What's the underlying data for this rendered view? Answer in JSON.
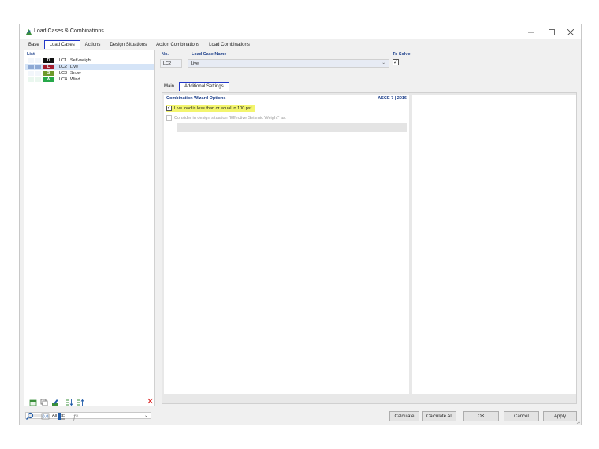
{
  "window": {
    "title": "Load Cases & Combinations"
  },
  "tabs": [
    {
      "label": "Base"
    },
    {
      "label": "Load Cases",
      "active": true
    },
    {
      "label": "Actions"
    },
    {
      "label": "Design Situations"
    },
    {
      "label": "Action Combinations"
    },
    {
      "label": "Load Combinations"
    }
  ],
  "list": {
    "title": "List",
    "items": [
      {
        "badge": "D",
        "badge_color": "#111111",
        "no": "LC1",
        "name": "Self-weight",
        "selected": false
      },
      {
        "badge": "L",
        "badge_color": "#a31c2e",
        "no": "LC2",
        "name": "Live",
        "selected": true
      },
      {
        "badge": "S",
        "badge_color": "#2d8a2d",
        "no": "LC3",
        "name": "Snow",
        "selected": false
      },
      {
        "badge": "W",
        "badge_color": "#27a84a",
        "no": "LC4",
        "name": "Wind",
        "selected": false
      }
    ],
    "filter_value": "All (4)"
  },
  "header": {
    "no_label": "No.",
    "no_value": "LC2",
    "name_label": "Load Case Name",
    "name_value": "Live",
    "solve_label": "To Solve",
    "to_solve": true
  },
  "subtabs": [
    {
      "label": "Main"
    },
    {
      "label": "Additional Settings",
      "active": true
    }
  ],
  "options": {
    "title": "Combination Wizard Options",
    "standard": "ASCE 7 | 2016",
    "live_load_label": "Live load is less than or equal to 100 psf",
    "live_load_checked": true,
    "seismic_label": "Consider in design situation \"Effective Seismic Weight\" as:",
    "seismic_checked": false
  },
  "buttons": {
    "calculate": "Calculate",
    "calculate_all": "Calculate All",
    "ok": "OK",
    "cancel": "Cancel",
    "apply": "Apply"
  },
  "colors": {
    "accent_outline": "#2238c8",
    "header_blue": "#1c3f8a",
    "highlight": "#f3f56e",
    "delete_red": "#d92020"
  }
}
